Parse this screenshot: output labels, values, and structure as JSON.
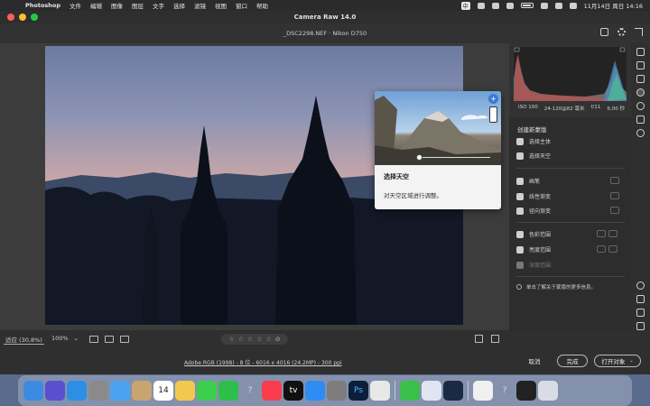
{
  "menubar": {
    "app_name": "Photoshop",
    "menus": [
      "文件",
      "编辑",
      "图像",
      "图层",
      "文字",
      "选择",
      "滤镜",
      "视图",
      "窗口",
      "帮助"
    ],
    "input_method": "中",
    "datetime": "11月14日 周日  14:16"
  },
  "window": {
    "title": "Camera Raw 14.0",
    "file_info": "_DSC2298.NEF  ·  Nikon D750"
  },
  "exif": {
    "iso": "ISO 100",
    "lens": "24-120@82 毫米",
    "aperture": "f/11",
    "shutter": "6,00 秒"
  },
  "popup": {
    "title": "选择天空",
    "description": "对天空区域进行调整。",
    "close_glyph": "+"
  },
  "mask_panel": {
    "header": "创建新蒙版",
    "items": [
      {
        "label": "选择主体",
        "icon": "person-icon"
      },
      {
        "label": "选择天空",
        "icon": "sky-icon"
      },
      {
        "label": "画笔",
        "icon": "brush-icon"
      },
      {
        "label": "线性渐变",
        "icon": "linear-gradient-icon"
      },
      {
        "label": "径向渐变",
        "icon": "radial-gradient-icon"
      },
      {
        "label": "色彩范围",
        "icon": "color-range-icon"
      },
      {
        "label": "亮度范围",
        "icon": "luminance-range-icon"
      },
      {
        "label": "深度范围",
        "icon": "depth-range-icon",
        "disabled": true
      }
    ],
    "info_text": "单击了解关于蒙版的更多信息。"
  },
  "bottom_bar": {
    "zoom_fit": "适应 (30,8%)",
    "zoom_pct": "100%",
    "chevron": "⌄",
    "stars": [
      "☆",
      "☆",
      "☆",
      "☆",
      "☆"
    ],
    "delete_glyph": "⊘"
  },
  "footer": {
    "workflow": "Adobe RGB (1998) - 8 位 - 6016 x 4016 (24.2MP) - 300 ppi",
    "cancel": "取消",
    "done": "完成",
    "open": "打开对象",
    "open_chevron": "⌄"
  },
  "colors": {
    "accent": "#3a7bd5",
    "panel": "#2d2d2d",
    "window_bg": "#3b3b3b"
  },
  "dock": {
    "calendar_day": "14",
    "apps": [
      "finder-icon",
      "siri-icon",
      "safari-icon",
      "launchpad-icon",
      "mail-icon",
      "notes-icon",
      "calendar-icon",
      "photos-icon",
      "messages-icon",
      "facetime-icon",
      "help-icon",
      "music-icon",
      "tv-icon",
      "app-store-icon",
      "system-preferences-icon",
      "photoshop-icon",
      "chrome-icon",
      "wechat-icon",
      "network-icon",
      "steam-icon",
      "preview-icon",
      "help-icon",
      "camera-raw-icon",
      "trash-icon"
    ],
    "labels": {
      "tv": "tv",
      "photoshop": "Ps",
      "help": "?"
    }
  }
}
